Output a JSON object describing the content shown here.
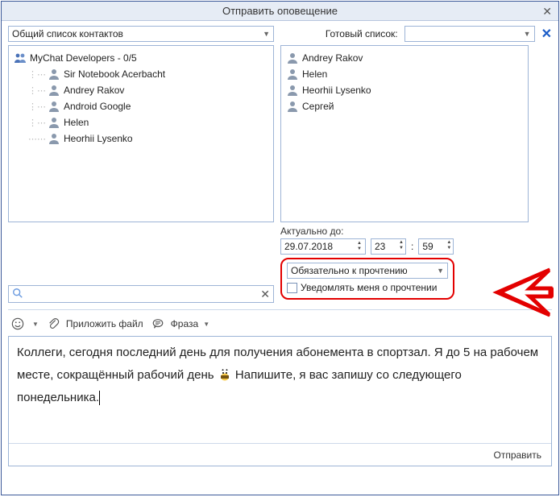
{
  "window": {
    "title": "Отправить оповещение"
  },
  "top": {
    "contacts_combo": "Общий список контактов",
    "ready_label": "Готовый список:",
    "ready_value": ""
  },
  "left_tree": {
    "group": "MyChat Developers - 0/5",
    "items": [
      "Sir Notebook Acerbacht",
      "Andrey Rakov",
      "Android Google",
      "Helen",
      "Heorhii Lysenko"
    ]
  },
  "right_list": [
    "Andrey Rakov",
    "Helen",
    "Heorhii Lysenko",
    "Сергей"
  ],
  "valid_until": {
    "label": "Актуально до:",
    "date": "29.07.2018",
    "hour": "23",
    "sep": ":",
    "minute": "59"
  },
  "highlight": {
    "combo": "Обязательно к прочтению",
    "checkbox_label": "Уведомлять меня о прочтении"
  },
  "toolbar": {
    "attach": "Приложить файл",
    "phrase": "Фраза"
  },
  "message": {
    "part1": "Коллеги, сегодня последний день для получения абонемента в спортзал. Я до 5 на рабочем месте, сокращённый рабочий день ",
    "part2": " Напишите, я вас запишу со следующего понедельника."
  },
  "send": "Отправить",
  "search": {
    "placeholder": ""
  }
}
